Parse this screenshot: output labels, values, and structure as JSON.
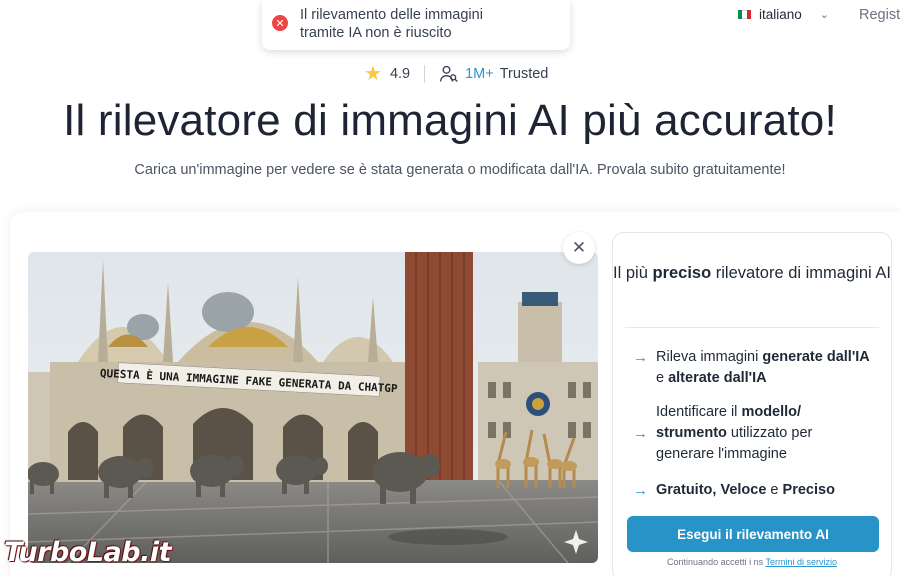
{
  "toast": {
    "message": "Il rilevamento delle immagini tramite IA non è riuscito"
  },
  "header": {
    "language": "italiano",
    "register": "Regist"
  },
  "rating": {
    "score": "4.9",
    "users_count": "1M+",
    "users_label": "Trusted"
  },
  "hero": {
    "title": "Il rilevatore di immagini AI più accurato!",
    "subtitle": "Carica un'immagine per vedere se è stata generata o modificata dall'IA. Provala subito gratuitamente!"
  },
  "photo": {
    "banner_text": "QUESTA È UNA IMMAGINE FAKE GENERATA DA CHATGP"
  },
  "panel": {
    "title_pre": "Il più ",
    "title_bold": "preciso",
    "title_post": " rilevatore di immagini AI",
    "feature1": {
      "a": "Rileva immagini ",
      "b": "generate dall'IA",
      "c": " e ",
      "d": "alterate dall'IA"
    },
    "feature2": {
      "a": "Identificare il ",
      "b": "modello/ strumento",
      "c": " utilizzato per generare l'immagine"
    },
    "feature3": {
      "a": "Gratuito, Veloce",
      "b": " e ",
      "c": "Preciso"
    },
    "cta_label": "Esegui il rilevamento AI",
    "terms_pre": "Continuando accetti i ns ",
    "terms_link": "Termini di servizio"
  },
  "watermark": "TurboLab.it",
  "colors": {
    "accent": "#2793c6",
    "error": "#ef4444",
    "star": "#f6c945"
  }
}
